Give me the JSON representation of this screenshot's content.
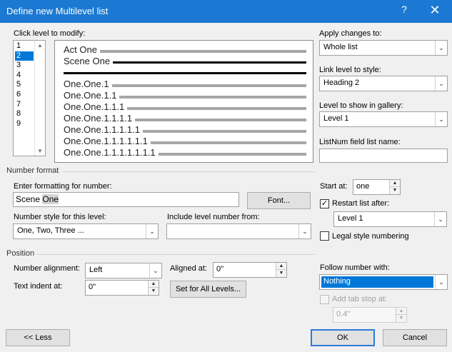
{
  "dialog": {
    "title": "Define new Multilevel list",
    "help_glyph": "?",
    "close_glyph": "✕"
  },
  "level_section": {
    "label": "Click level to modify:",
    "levels": [
      "1",
      "2",
      "3",
      "4",
      "5",
      "6",
      "7",
      "8",
      "9"
    ],
    "selected_level": "2"
  },
  "preview": {
    "lines": [
      "Act One",
      "Scene One",
      "One.One.1",
      "One.One.1.1",
      "One.One.1.1.1",
      "One.One.1.1.1.1",
      "One.One.1.1.1.1.1",
      "One.One.1.1.1.1.1.1",
      "One.One.1.1.1.1.1.1.1"
    ]
  },
  "right_panel": {
    "apply_label": "Apply changes to:",
    "apply_value": "Whole list",
    "link_label": "Link level to style:",
    "link_value": "Heading 2",
    "gallery_label": "Level to show in gallery:",
    "gallery_value": "Level 1",
    "listnum_label": "ListNum field list name:",
    "listnum_value": ""
  },
  "number_format": {
    "section_label": "Number format",
    "enter_label": "Enter formatting for number:",
    "format_plain": "Scene ",
    "format_field": "One",
    "font_button": "Font...",
    "style_label": "Number style for this level:",
    "style_value": "One, Two, Three ...",
    "include_label": "Include level number from:",
    "include_value": "",
    "start_label": "Start at:",
    "start_value": "one",
    "restart_label": "Restart list after:",
    "restart_checked": true,
    "restart_value": "Level 1",
    "legal_label": "Legal style numbering",
    "legal_checked": false
  },
  "position": {
    "section_label": "Position",
    "alignment_label": "Number alignment:",
    "alignment_value": "Left",
    "aligned_at_label": "Aligned at:",
    "aligned_at_value": "0\"",
    "indent_label": "Text indent at:",
    "indent_value": "0\"",
    "set_all_button": "Set for All Levels...",
    "follow_label": "Follow number with:",
    "follow_value": "Nothing",
    "tab_stop_label": "Add tab stop at:",
    "tab_stop_value": "0.4\""
  },
  "footer": {
    "less_button": "<< Less",
    "ok_button": "OK",
    "cancel_button": "Cancel"
  },
  "colors": {
    "titlebar": "#1b79d3",
    "selection": "#0078d7"
  }
}
